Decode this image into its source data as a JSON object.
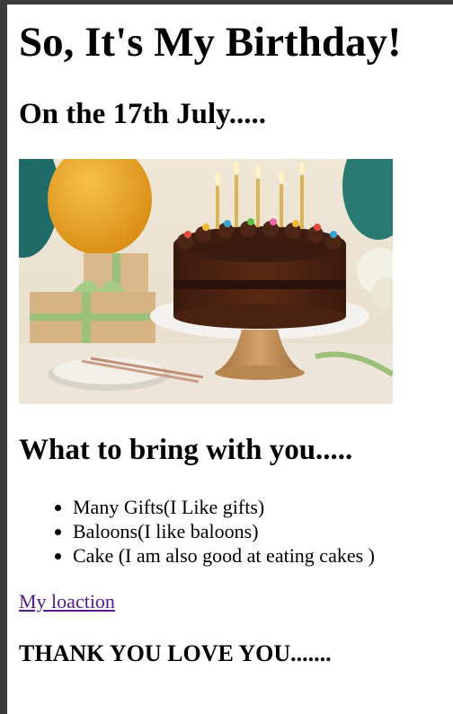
{
  "page": {
    "title": "So, It's My Birthday!",
    "date_heading": "On the 17th July.....",
    "image": "birthday-cake-photo",
    "bring_heading": "What to bring with you.....",
    "bring_items": [
      "Many Gifts(I Like gifts)",
      "Baloons(I like baloons)",
      "Cake (I am also good at eating cakes )"
    ],
    "location_link": "My loaction",
    "thanks": "THANK YOU LOVE YOU......."
  },
  "colors": {
    "link": "#551a8b",
    "frame": "#3c3c3c"
  }
}
